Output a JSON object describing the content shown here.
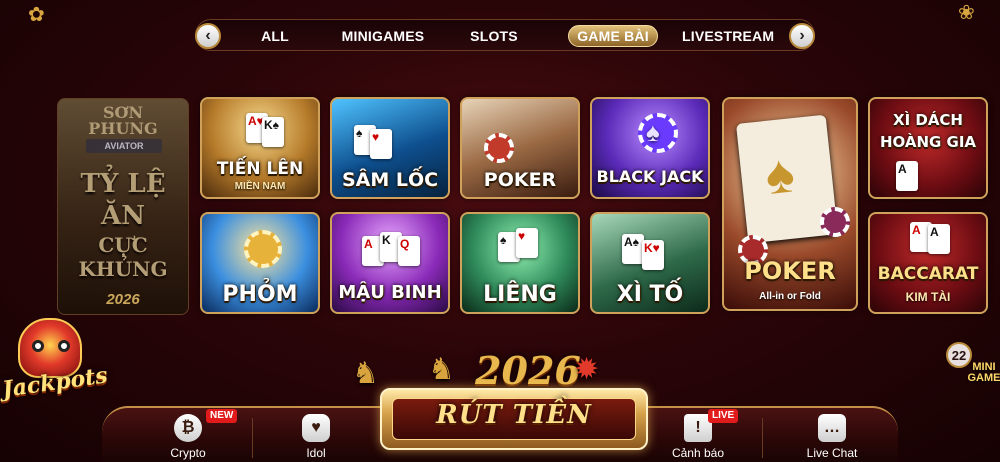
{
  "nav": {
    "tabs": [
      {
        "label": "ALL",
        "active": false
      },
      {
        "label": "MINIGAMES",
        "active": false
      },
      {
        "label": "SLOTS",
        "active": false
      },
      {
        "label": "GAME BÀI",
        "active": true
      },
      {
        "label": "LIVESTREAM",
        "active": false
      }
    ],
    "prev_glyph": "‹",
    "next_glyph": "›"
  },
  "promo": {
    "brand_line1": "SƠN",
    "brand_line2": "PHUNG",
    "badge": "AVIATOR",
    "line1": "TỶ LỆ",
    "line2": "ĂN",
    "line3": "CỰC KHỦNG",
    "year": "2026"
  },
  "games": [
    {
      "title": "TIẾN LÊN",
      "subtitle": "MIỀN NAM",
      "theme": "#c8913e"
    },
    {
      "title": "SÂM LỐC",
      "subtitle": "",
      "theme": "#1f8fc9"
    },
    {
      "title": "POKER",
      "subtitle": "",
      "theme": "#b08a6a"
    },
    {
      "title": "BLACK JACK",
      "subtitle": "",
      "theme": "#5a2fb0"
    },
    {
      "title": "PHỎM",
      "subtitle": "",
      "theme": "#2b7fd0"
    },
    {
      "title": "MẬU BINH",
      "subtitle": "",
      "theme": "#8a2fb0"
    },
    {
      "title": "LIÊNG",
      "subtitle": "",
      "theme": "#2f9a5a"
    },
    {
      "title": "XÌ TỐ",
      "subtitle": "",
      "theme": "#2e7a4e"
    },
    {
      "title": "POKER",
      "subtitle": "All-in or Fold",
      "theme": "#6a2a1a"
    },
    {
      "title": "XÌ DÁCH HOÀNG GIA",
      "subtitle": "",
      "theme": "#5a0c12"
    },
    {
      "title": "BACCARAT",
      "subtitle": "KIM TÀI",
      "theme": "#5a0c12"
    }
  ],
  "jackpot": {
    "label": "Jackpots"
  },
  "minigame": {
    "count": "22",
    "label": "MINI GAME"
  },
  "decoration": {
    "year": "2026"
  },
  "bottom_bar": {
    "crypto": {
      "label": "Crypto",
      "badge": "NEW",
      "icon": "bitcoin-icon"
    },
    "idol": {
      "label": "Idol",
      "icon": "heart-icon"
    },
    "withdraw": {
      "label": "RÚT TIỀN"
    },
    "warning": {
      "label": "Cảnh báo",
      "badge": "LIVE",
      "icon": "warning-icon"
    },
    "livechat": {
      "label": "Live Chat",
      "icon": "chat-icon"
    }
  },
  "colors": {
    "accent_gold": "#cfa15a",
    "background": "#2a0508",
    "badge_red": "#e11b1b"
  }
}
